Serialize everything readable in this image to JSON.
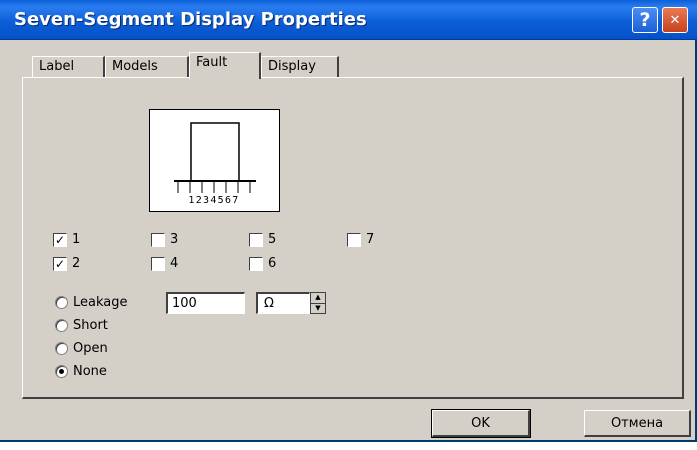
{
  "window": {
    "title": "Seven-Segment Display Properties",
    "help_glyph": "?",
    "close_glyph": "✕"
  },
  "tabs": [
    {
      "label": "Label",
      "active": false
    },
    {
      "label": "Models",
      "active": false
    },
    {
      "label": "Fault",
      "active": true
    },
    {
      "label": "Display",
      "active": false
    }
  ],
  "diagram": {
    "pin_labels": "1234567"
  },
  "pins": [
    {
      "label": "1",
      "checked": true
    },
    {
      "label": "2",
      "checked": true
    },
    {
      "label": "3",
      "checked": false
    },
    {
      "label": "4",
      "checked": false
    },
    {
      "label": "5",
      "checked": false
    },
    {
      "label": "6",
      "checked": false
    },
    {
      "label": "7",
      "checked": false
    }
  ],
  "fault_modes": [
    {
      "label": "Leakage",
      "selected": false
    },
    {
      "label": "Short",
      "selected": false
    },
    {
      "label": "Open",
      "selected": false
    },
    {
      "label": "None",
      "selected": true
    }
  ],
  "leakage": {
    "value": "100",
    "unit": "Ω"
  },
  "buttons": {
    "ok": "OK",
    "cancel": "Отмена"
  },
  "colors": {
    "titlebar": "#0b5fd7",
    "dialog_bg": "#d4d0c8"
  }
}
